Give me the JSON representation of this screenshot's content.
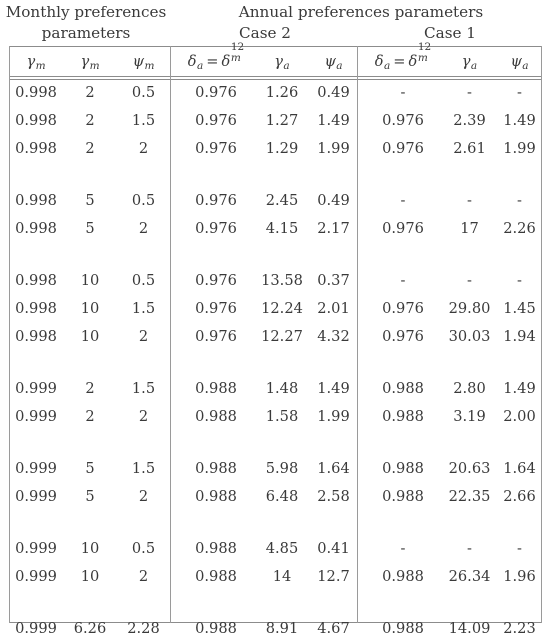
{
  "table": {
    "super_headers": {
      "monthly_line1": "Monthly preferences",
      "monthly_line2": "parameters",
      "annual": "Annual preferences parameters",
      "case2": "Case 2",
      "case1": "Case 1"
    },
    "column_headers": {
      "monthly": [
        "γ",
        "γ",
        "ψ"
      ],
      "monthly_subs": [
        "m",
        "m",
        "m"
      ],
      "case2": [
        "δ_a = δ_m^12",
        "γ_a",
        "ψ_a"
      ],
      "case1": [
        "δ_a = δ_m^12",
        "γ_a",
        "ψ_a"
      ],
      "delta_base": "δ",
      "delta_sub": "a",
      "delta_rhs_base": "δ",
      "delta_rhs_sup": "12",
      "delta_rhs_sub": "m",
      "gamma": "γ",
      "psi": "ψ",
      "sub_a": "a",
      "equals": "="
    },
    "rows": [
      {
        "type": "data",
        "monthly": [
          "0.998",
          "2",
          "0.5"
        ],
        "case2": [
          "0.976",
          "1.26",
          "0.49"
        ],
        "case1": [
          "-",
          "-",
          "-"
        ]
      },
      {
        "type": "data",
        "monthly": [
          "0.998",
          "2",
          "1.5"
        ],
        "case2": [
          "0.976",
          "1.27",
          "1.49"
        ],
        "case1": [
          "0.976",
          "2.39",
          "1.49"
        ]
      },
      {
        "type": "data",
        "monthly": [
          "0.998",
          "2",
          "2"
        ],
        "case2": [
          "0.976",
          "1.29",
          "1.99"
        ],
        "case1": [
          "0.976",
          "2.61",
          "1.99"
        ]
      },
      {
        "type": "gap"
      },
      {
        "type": "data",
        "monthly": [
          "0.998",
          "5",
          "0.5"
        ],
        "case2": [
          "0.976",
          "2.45",
          "0.49"
        ],
        "case1": [
          "-",
          "-",
          "-"
        ]
      },
      {
        "type": "data",
        "monthly": [
          "0.998",
          "5",
          "2"
        ],
        "case2": [
          "0.976",
          "4.15",
          "2.17"
        ],
        "case1": [
          "0.976",
          "17",
          "2.26"
        ]
      },
      {
        "type": "gap"
      },
      {
        "type": "data",
        "monthly": [
          "0.998",
          "10",
          "0.5"
        ],
        "case2": [
          "0.976",
          "13.58",
          "0.37"
        ],
        "case1": [
          "-",
          "-",
          "-"
        ]
      },
      {
        "type": "data",
        "monthly": [
          "0.998",
          "10",
          "1.5"
        ],
        "case2": [
          "0.976",
          "12.24",
          "2.01"
        ],
        "case1": [
          "0.976",
          "29.80",
          "1.45"
        ]
      },
      {
        "type": "data",
        "monthly": [
          "0.998",
          "10",
          "2"
        ],
        "case2": [
          "0.976",
          "12.27",
          "4.32"
        ],
        "case1": [
          "0.976",
          "30.03",
          "1.94"
        ]
      },
      {
        "type": "gap"
      },
      {
        "type": "data",
        "monthly": [
          "0.999",
          "2",
          "1.5"
        ],
        "case2": [
          "0.988",
          "1.48",
          "1.49"
        ],
        "case1": [
          "0.988",
          "2.80",
          "1.49"
        ]
      },
      {
        "type": "data",
        "monthly": [
          "0.999",
          "2",
          "2"
        ],
        "case2": [
          "0.988",
          "1.58",
          "1.99"
        ],
        "case1": [
          "0.988",
          "3.19",
          "2.00"
        ]
      },
      {
        "type": "gap"
      },
      {
        "type": "data",
        "monthly": [
          "0.999",
          "5",
          "1.5"
        ],
        "case2": [
          "0.988",
          "5.98",
          "1.64"
        ],
        "case1": [
          "0.988",
          "20.63",
          "1.64"
        ]
      },
      {
        "type": "data",
        "monthly": [
          "0.999",
          "5",
          "2"
        ],
        "case2": [
          "0.988",
          "6.48",
          "2.58"
        ],
        "case1": [
          "0.988",
          "22.35",
          "2.66"
        ]
      },
      {
        "type": "gap"
      },
      {
        "type": "data",
        "monthly": [
          "0.999",
          "10",
          "0.5"
        ],
        "case2": [
          "0.988",
          "4.85",
          "0.41"
        ],
        "case1": [
          "-",
          "-",
          "-"
        ]
      },
      {
        "type": "data",
        "monthly": [
          "0.999",
          "10",
          "2"
        ],
        "case2": [
          "0.988",
          "14",
          "12.7"
        ],
        "case1": [
          "0.988",
          "26.34",
          "1.96"
        ]
      },
      {
        "type": "gap"
      },
      {
        "type": "data",
        "monthly": [
          "0.999",
          "6.26",
          "2.28"
        ],
        "case2": [
          "0.988",
          "8.91",
          "4.67"
        ],
        "case1": [
          "0.988",
          "14.09",
          "2.23"
        ]
      }
    ],
    "colors": {
      "text": "#3a3a3a",
      "rule": "#8c8c8c",
      "background": "#ffffff"
    }
  }
}
